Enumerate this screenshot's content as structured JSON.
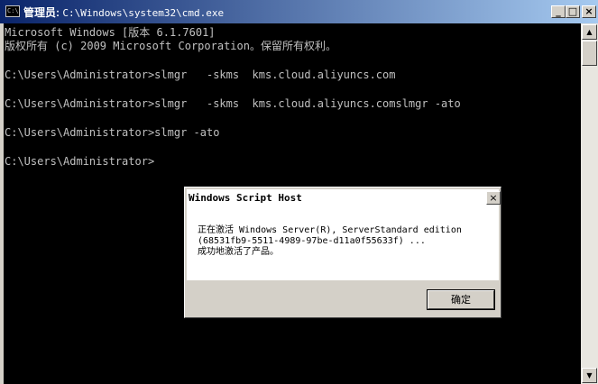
{
  "window": {
    "icon_text": "C:\\",
    "title_prefix": "管理员: ",
    "title_path": "C:\\Windows\\system32\\cmd.exe",
    "minimize": "_",
    "maximize": "□",
    "close": "×"
  },
  "console": {
    "lines": [
      "Microsoft Windows [版本 6.1.7601]",
      "版权所有 (c) 2009 Microsoft Corporation。保留所有权利。",
      "",
      "C:\\Users\\Administrator>slmgr   -skms  kms.cloud.aliyuncs.com",
      "",
      "C:\\Users\\Administrator>slmgr   -skms  kms.cloud.aliyuncs.comslmgr -ato",
      "",
      "C:\\Users\\Administrator>slmgr -ato",
      "",
      "C:\\Users\\Administrator>"
    ]
  },
  "scrollbar": {
    "up": "▲",
    "down": "▼"
  },
  "dialog": {
    "title": "Windows Script Host",
    "close": "×",
    "message_lines": [
      "正在激活 Windows Server(R), ServerStandard edition",
      "(68531fb9-5511-4989-97be-d11a0f55633f) ...",
      "成功地激活了产品。"
    ],
    "ok_label": "确定"
  }
}
